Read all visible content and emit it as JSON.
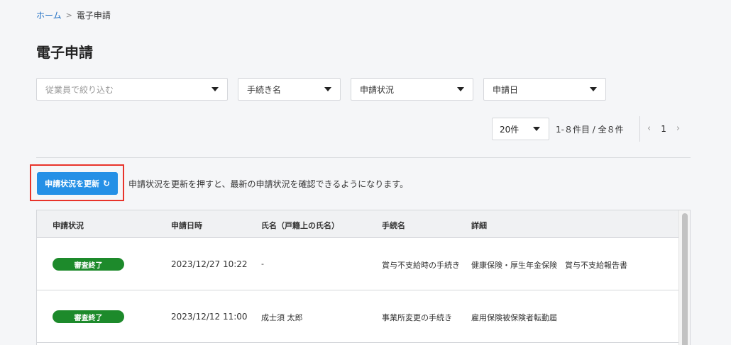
{
  "breadcrumb": {
    "home": "ホーム",
    "separator": ">",
    "current": "電子申請"
  },
  "page": {
    "title": "電子申請"
  },
  "filters": {
    "employee_placeholder": "従業員で絞り込む",
    "procedure": "手続き名",
    "status": "申請状況",
    "date": "申請日"
  },
  "pagination": {
    "per_page": "20件",
    "range_text": "1-８件目 / 全８件",
    "current_page": "1"
  },
  "refresh": {
    "button_label": "申請状況を更新",
    "hint": "申請状況を更新を押すと、最新の申請状況を確認できるようになります。"
  },
  "table": {
    "headers": [
      "申請状況",
      "申請日時",
      "氏名（戸籍上の氏名）",
      "手続名",
      "詳細"
    ],
    "rows": [
      {
        "status": "審査終了",
        "datetime": "2023/12/27 10:22",
        "name": "-",
        "procedure": "賞与不支給時の手続き",
        "detail": "健康保険・厚生年金保険　賞与不支給報告書"
      },
      {
        "status": "審査終了",
        "datetime": "2023/12/12 11:00",
        "name": "成士須 太郎",
        "procedure": "事業所変更の手続き",
        "detail": "雇用保険被保険者転勤届"
      }
    ]
  },
  "colors": {
    "accent": "#2590e6",
    "status_done": "#1d8a2b",
    "highlight": "#e8332a"
  }
}
